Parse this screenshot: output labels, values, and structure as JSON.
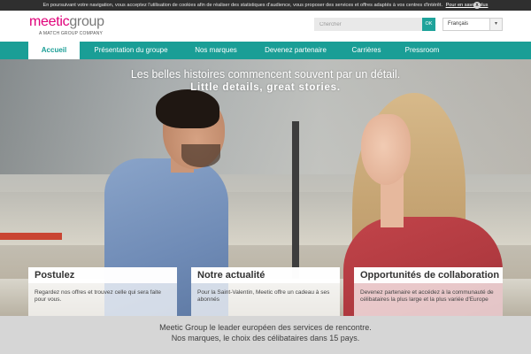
{
  "cookie_bar": {
    "text": "En poursuivant votre navigation, vous acceptez l'utilisation de cookies afin de réaliser des statistiques d'audience, vous proposer des services et offres adaptés à vos centres d'intérêt.",
    "link": "Pour en savoir plus",
    "close": "x"
  },
  "header": {
    "logo_meetic": "meetic",
    "logo_group": "group",
    "logo_tagline": "A MATCH GROUP COMPANY",
    "search_placeholder": "Chercher",
    "search_button": "OK",
    "language": "Français"
  },
  "nav": {
    "items": [
      {
        "label": "Accueil"
      },
      {
        "label": "Présentation du groupe"
      },
      {
        "label": "Nos marques"
      },
      {
        "label": "Devenez partenaire"
      },
      {
        "label": "Carrières"
      },
      {
        "label": "Pressroom"
      }
    ]
  },
  "hero": {
    "headline_fr": "Les belles histoires commencent souvent par un détail.",
    "headline_en": "Little details, great stories."
  },
  "cards": [
    {
      "title": "Postulez",
      "desc": "Regardez nos offres et trouvez celle qui sera faite pour vous."
    },
    {
      "title": "Notre actualité",
      "desc": "Pour la Saint-Valentin, Meetic offre un cadeau à ses abonnés"
    },
    {
      "title": "Opportunités de collaboration",
      "desc": "Devenez partenaire et accédez à la communauté de célibataires la plus large et la plus variée d'Europe"
    }
  ],
  "footer": {
    "line1": "Meetic Group le leader européen des services de rencontre.",
    "line2": "Nos marques, le choix des célibataires dans 15 pays."
  },
  "colors": {
    "accent": "#1a9e96",
    "brand_pink": "#e0007a"
  }
}
